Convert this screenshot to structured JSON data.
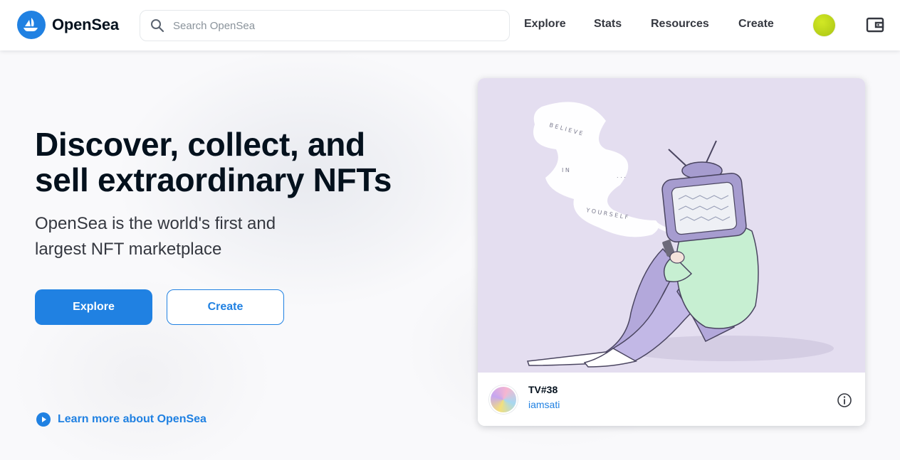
{
  "brand": {
    "name": "OpenSea",
    "accent": "#2081e2"
  },
  "search": {
    "placeholder": "Search OpenSea",
    "value": ""
  },
  "nav": {
    "links": [
      {
        "label": "Explore"
      },
      {
        "label": "Stats"
      },
      {
        "label": "Resources"
      },
      {
        "label": "Create"
      }
    ],
    "account_icon": "avatar-icon",
    "wallet_icon": "wallet-icon"
  },
  "hero": {
    "title_line1": "Discover, collect, and",
    "title_line2": "sell extraordinary NFTs",
    "subtitle_line1": "OpenSea is the world's first and",
    "subtitle_line2": "largest NFT marketplace",
    "primary_button": "Explore",
    "secondary_button": "Create",
    "learn_more": "Learn more about OpenSea"
  },
  "featured": {
    "name": "TV#38",
    "creator": "iamsati",
    "art_text": [
      "B E L I E V E",
      "I N",
      ". . .",
      "Y O U R S E L F"
    ]
  }
}
